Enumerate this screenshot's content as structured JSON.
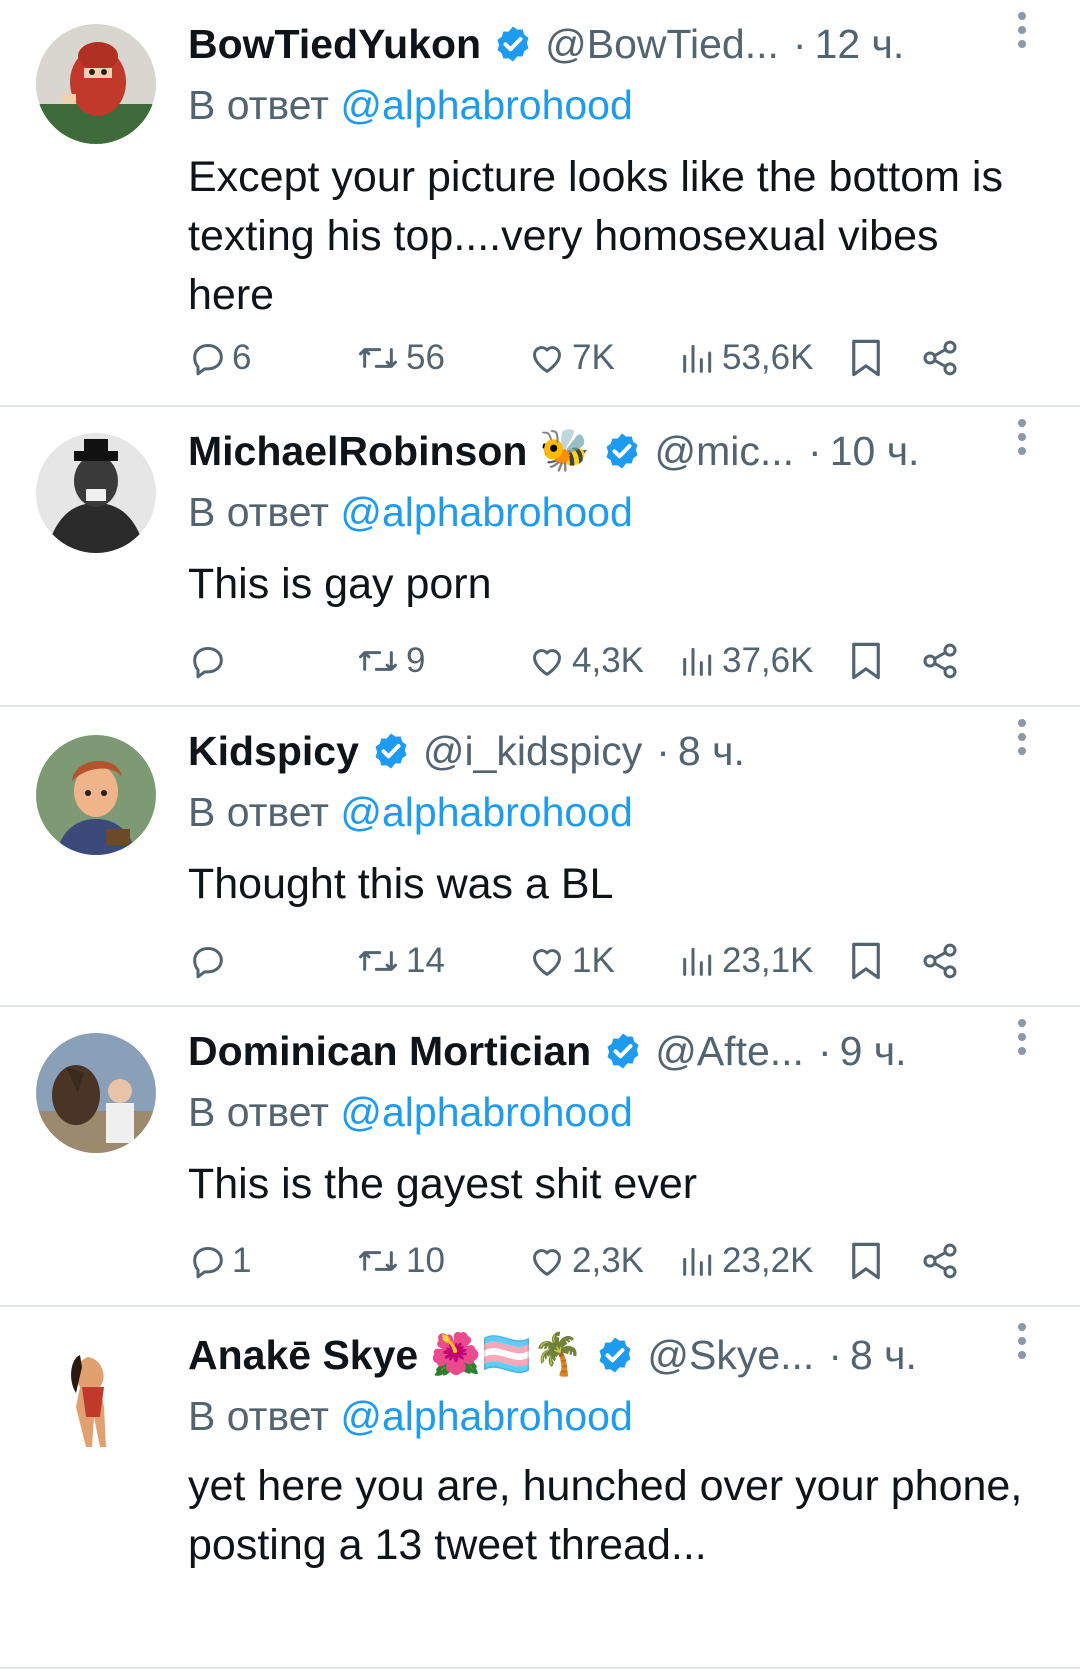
{
  "reply_prefix": "В ответ",
  "tweets": [
    {
      "name": "BowTiedYukon",
      "emoji": "",
      "handle": "@BowTied...",
      "dot": "·",
      "time": "12 ч.",
      "reply_to": "@alphabrohood",
      "text": "Except your picture looks like the bottom is texting his top....very homosexual vibes here",
      "stats": {
        "replies": "6",
        "retweets": "56",
        "likes": "7K",
        "views": "53,6K"
      },
      "avatar_icon": "red-bearded-miner-avatar"
    },
    {
      "name": "MichaelRobinson",
      "emoji": "🐝",
      "handle": "@mic...",
      "dot": "·",
      "time": "10 ч.",
      "reply_to": "@alphabrohood",
      "text": "This is gay porn",
      "stats": {
        "replies": "",
        "retweets": "9",
        "likes": "4,3K",
        "views": "37,6K"
      },
      "avatar_icon": "black-white-character-avatar"
    },
    {
      "name": "Kidspicy",
      "emoji": "",
      "handle": "@i_kidspicy",
      "dot": "·",
      "time": "8 ч.",
      "reply_to": "@alphabrohood",
      "text": "Thought this was a BL",
      "stats": {
        "replies": "",
        "retweets": "14",
        "likes": "1K",
        "views": "23,1K"
      },
      "avatar_icon": "cartoon-boy-avatar"
    },
    {
      "name": "Dominican Mortician",
      "emoji": "",
      "handle": "@Afte...",
      "dot": "·",
      "time": "9 ч.",
      "reply_to": "@alphabrohood",
      "text": "This is the gayest shit ever",
      "stats": {
        "replies": "1",
        "retweets": "10",
        "likes": "2,3K",
        "views": "23,2K"
      },
      "avatar_icon": "person-with-horse-avatar"
    },
    {
      "name": "Anakē Skye",
      "emoji": "🌺🏳️‍⚧️🌴",
      "handle": "@Skye...",
      "dot": "·",
      "time": "8 ч.",
      "reply_to": "@alphabrohood",
      "text": "yet here you are, hunched over your phone, posting a 13 tweet thread...",
      "stats": {
        "replies": "",
        "retweets": "",
        "likes": "",
        "views": ""
      },
      "avatar_icon": "illustrated-woman-avatar"
    }
  ],
  "colors": {
    "text": "#0f1419",
    "secondary": "#536471",
    "link": "#1d9bf0",
    "verified": "#1d9bf0",
    "divider": "#e1e5e9"
  }
}
